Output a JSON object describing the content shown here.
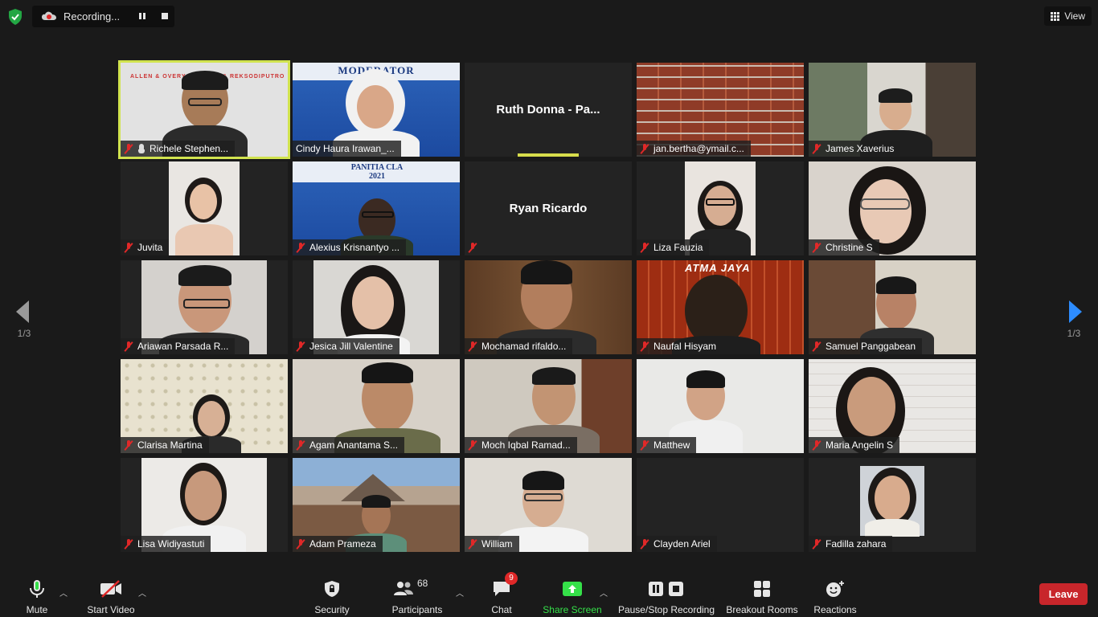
{
  "top": {
    "recording_label": "Recording...",
    "view_label": "View"
  },
  "pager": {
    "left_page": "1/3",
    "right_page": "1/3"
  },
  "participants": [
    {
      "name": "Richele Stephen...",
      "muted": true,
      "hand_raised": true,
      "active": true,
      "video": true,
      "banner": "ALLEN & OVERY    ROSIANG & REKSODIPUTRO"
    },
    {
      "name": "Cindy Haura Irawan_...",
      "muted": false,
      "video": true,
      "banner": "MODERATOR"
    },
    {
      "name_center": "Ruth Donna - Pa...",
      "video": false,
      "speaking": true
    },
    {
      "name": "jan.bertha@ymail.c...",
      "muted": true,
      "video": true
    },
    {
      "name": "James Xaverius",
      "muted": true,
      "video": true
    },
    {
      "name": "Juvita",
      "muted": true,
      "video": true
    },
    {
      "name": "Alexius Krisnantyo ...",
      "muted": true,
      "video": true,
      "banner": "PANITIA CLA 2021"
    },
    {
      "name_center": "Ryan Ricardo",
      "muted": true,
      "video": false
    },
    {
      "name": "Liza Fauzia",
      "muted": true,
      "video": true
    },
    {
      "name": "Christine S",
      "muted": true,
      "video": true
    },
    {
      "name": "Ariawan Parsada R...",
      "muted": true,
      "video": true
    },
    {
      "name": "Jesica Jill Valentine",
      "muted": true,
      "video": true
    },
    {
      "name": "Mochamad rifaldo...",
      "muted": true,
      "video": true
    },
    {
      "name": "Naufal Hisyam",
      "muted": true,
      "video": true,
      "banner": "ATMA JAYA"
    },
    {
      "name": "Samuel Panggabean",
      "muted": true,
      "video": true
    },
    {
      "name": "Clarisa Martina",
      "muted": true,
      "video": true
    },
    {
      "name": "Agam Anantama S...",
      "muted": true,
      "video": true
    },
    {
      "name": "Moch Iqbal Ramad...",
      "muted": true,
      "video": true
    },
    {
      "name": "Matthew",
      "muted": true,
      "video": true
    },
    {
      "name": "Maria Angelin S",
      "muted": true,
      "video": true
    },
    {
      "name": "Lisa Widiyastuti",
      "muted": true,
      "video": true
    },
    {
      "name": "Adam Prameza",
      "muted": true,
      "video": true
    },
    {
      "name": "William",
      "muted": true,
      "video": true
    },
    {
      "name": "Clayden Ariel",
      "muted": true,
      "video": false
    },
    {
      "name": "Fadilla zahara",
      "muted": true,
      "video": true
    }
  ],
  "toolbar": {
    "mute": "Mute",
    "start_video": "Start Video",
    "security": "Security",
    "participants": "Participants",
    "participants_count": "68",
    "chat": "Chat",
    "chat_badge": "9",
    "share_screen": "Share Screen",
    "pause_stop_recording": "Pause/Stop Recording",
    "breakout_rooms": "Breakout Rooms",
    "reactions": "Reactions",
    "leave": "Leave"
  },
  "colors": {
    "active_speaker": "#d1e34f",
    "share_green": "#35e049",
    "leave_red": "#c8262b",
    "muted_red": "#e02828"
  }
}
